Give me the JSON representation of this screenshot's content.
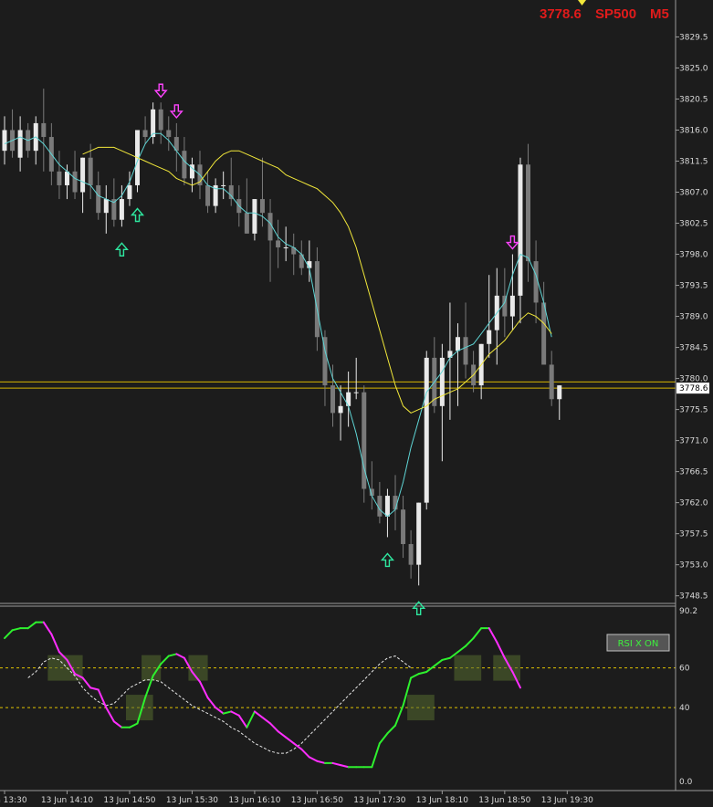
{
  "header": {
    "price": "3778.6",
    "symbol": "SP500",
    "timeframe": "M5"
  },
  "colors": {
    "background": "#1c1c1c",
    "candle_up": "#e9e9e9",
    "candle_down": "#7a7a7a",
    "ma_fast": "#5fd6d6",
    "ma_slow": "#f2e83a",
    "price_line": "#d6b400",
    "rsi_up": "#2ef02e",
    "rsi_down": "#ff2eff",
    "signal_up": "#2ee8a0",
    "signal_down": "#ff44ff"
  },
  "button": {
    "label": "RSI X ON"
  },
  "chart_data": [
    {
      "type": "candlestick",
      "title": "",
      "ylim": [
        3747.0,
        3833.0
      ],
      "y_ticks": [
        "3829.5",
        "3825.0",
        "3820.5",
        "3816.0",
        "3811.5",
        "3807.0",
        "3802.5",
        "3798.0",
        "3793.5",
        "3789.0",
        "3784.5",
        "3780.0",
        "3775.5",
        "3771.0",
        "3766.5",
        "3762.0",
        "3757.5",
        "3753.0",
        "3748.5"
      ],
      "current_price": 3778.6,
      "price_lines": [
        3779.5,
        3778.6
      ],
      "x_ticks": [
        "13 Jun 13:30",
        "13 Jun 14:10",
        "13 Jun 14:50",
        "13 Jun 15:30",
        "13 Jun 16:10",
        "13 Jun 16:50",
        "13 Jun 17:30",
        "13 Jun 18:10",
        "13 Jun 18:50",
        "13 Jun 19:30"
      ],
      "x_tick_bars": [
        0,
        8,
        16,
        24,
        32,
        40,
        48,
        56,
        64,
        72
      ],
      "candles_ohlc": [
        [
          3813,
          3818,
          3811,
          3816
        ],
        [
          3816,
          3819,
          3812,
          3813
        ],
        [
          3812,
          3818,
          3810,
          3816
        ],
        [
          3816,
          3817,
          3812,
          3813
        ],
        [
          3813,
          3818,
          3811,
          3817
        ],
        [
          3817,
          3822,
          3810,
          3815
        ],
        [
          3815,
          3817,
          3808,
          3810
        ],
        [
          3810,
          3813,
          3806,
          3808
        ],
        [
          3808,
          3811,
          3806,
          3810
        ],
        [
          3810,
          3813,
          3806,
          3807
        ],
        [
          3807,
          3812,
          3804,
          3812
        ],
        [
          3812,
          3814,
          3806,
          3808
        ],
        [
          3808,
          3810,
          3803,
          3804
        ],
        [
          3804,
          3808,
          3801,
          3806
        ],
        [
          3806,
          3809,
          3802,
          3803
        ],
        [
          3803,
          3808,
          3802,
          3806
        ],
        [
          3806,
          3810,
          3805,
          3808
        ],
        [
          3808,
          3816,
          3807,
          3816
        ],
        [
          3816,
          3818,
          3814,
          3815
        ],
        [
          3815,
          3820,
          3814,
          3819
        ],
        [
          3819,
          3820,
          3814,
          3816
        ],
        [
          3816,
          3818,
          3813,
          3815
        ],
        [
          3815,
          3817,
          3810,
          3813
        ],
        [
          3813,
          3815,
          3808,
          3809
        ],
        [
          3809,
          3812,
          3807,
          3811
        ],
        [
          3811,
          3813,
          3806,
          3808
        ],
        [
          3808,
          3810,
          3804,
          3805
        ],
        [
          3805,
          3809,
          3804,
          3808
        ],
        [
          3808,
          3810,
          3806,
          3808
        ],
        [
          3808,
          3812,
          3805,
          3806
        ],
        [
          3806,
          3808,
          3802,
          3804
        ],
        [
          3804,
          3809,
          3801,
          3801
        ],
        [
          3801,
          3806,
          3800,
          3806
        ],
        [
          3806,
          3812,
          3802,
          3804
        ],
        [
          3804,
          3806,
          3794,
          3800
        ],
        [
          3800,
          3803,
          3796,
          3799
        ],
        [
          3799,
          3802,
          3797,
          3799
        ],
        [
          3799,
          3801,
          3795,
          3798
        ],
        [
          3798,
          3800,
          3795,
          3796
        ],
        [
          3796,
          3800,
          3794,
          3797
        ],
        [
          3797,
          3799,
          3784,
          3786
        ],
        [
          3786,
          3787,
          3776,
          3779
        ],
        [
          3779,
          3782,
          3773,
          3775
        ],
        [
          3775,
          3779,
          3771,
          3776
        ],
        [
          3776,
          3781,
          3773,
          3778
        ],
        [
          3778,
          3783,
          3777,
          3778
        ],
        [
          3778,
          3779,
          3762,
          3764
        ],
        [
          3764,
          3768,
          3761,
          3763
        ],
        [
          3763,
          3765,
          3759,
          3760
        ],
        [
          3760,
          3764,
          3757,
          3763
        ],
        [
          3763,
          3766,
          3758,
          3761
        ],
        [
          3761,
          3763,
          3754,
          3756
        ],
        [
          3756,
          3758,
          3751,
          3753
        ],
        [
          3753,
          3762,
          3750,
          3762
        ],
        [
          3762,
          3784,
          3761,
          3783
        ],
        [
          3783,
          3786,
          3775,
          3776
        ],
        [
          3776,
          3785,
          3768,
          3783
        ],
        [
          3783,
          3791,
          3774,
          3784
        ],
        [
          3784,
          3788,
          3776,
          3786
        ],
        [
          3786,
          3791,
          3780,
          3782
        ],
        [
          3782,
          3784,
          3778,
          3779
        ],
        [
          3779,
          3785,
          3777,
          3785
        ],
        [
          3785,
          3795,
          3783,
          3787
        ],
        [
          3787,
          3796,
          3782,
          3792
        ],
        [
          3792,
          3796,
          3786,
          3789
        ],
        [
          3789,
          3798,
          3787,
          3792
        ],
        [
          3792,
          3812,
          3788,
          3811
        ],
        [
          3811,
          3814,
          3794,
          3797
        ],
        [
          3797,
          3800,
          3788,
          3791
        ],
        [
          3791,
          3794,
          3785,
          3782
        ],
        [
          3782,
          3784,
          3776,
          3777
        ],
        [
          3777,
          3779,
          3774,
          3779
        ]
      ],
      "ma_fast": [
        3814,
        3814.5,
        3815,
        3814.5,
        3815,
        3814,
        3812.5,
        3811,
        3810,
        3809,
        3808.5,
        3808,
        3806.5,
        3806,
        3805.5,
        3806.5,
        3808.5,
        3811.5,
        3814,
        3815.5,
        3815.5,
        3814.5,
        3813,
        3811.5,
        3810.5,
        3809.5,
        3808,
        3807.5,
        3807.5,
        3806.5,
        3805,
        3804,
        3804,
        3803.5,
        3802.5,
        3800.5,
        3799.5,
        3799,
        3798,
        3796,
        3790,
        3784,
        3780,
        3778,
        3776,
        3772,
        3767,
        3763,
        3761,
        3760,
        3761,
        3765,
        3770,
        3774,
        3778,
        3779.5,
        3781,
        3783,
        3784,
        3784.5,
        3785,
        3786.5,
        3788,
        3789.5,
        3791,
        3795,
        3798,
        3797.5,
        3795,
        3791,
        3786
      ],
      "ma_slow": [
        3812.5,
        3813,
        3813.5,
        3813.5,
        3813.5,
        3813,
        3812.5,
        3812,
        3811.5,
        3811,
        3810.5,
        3810,
        3809,
        3808.5,
        3808,
        3808.5,
        3810,
        3811.5,
        3812.5,
        3813,
        3813,
        3812.5,
        3812,
        3811.5,
        3811,
        3810.5,
        3809.5,
        3809,
        3808.5,
        3808,
        3807.5,
        3806.5,
        3805.5,
        3804,
        3802,
        3799,
        3795,
        3791,
        3787,
        3783,
        3779,
        3776,
        3775,
        3775.5,
        3776,
        3777,
        3777.5,
        3778,
        3778.5,
        3779.5,
        3780.5,
        3782,
        3783.5,
        3784.5,
        3785.5,
        3787,
        3788.5,
        3789.5,
        3789,
        3788,
        3786.5
      ],
      "ma_slow_start_bar": 10,
      "signals_up_bars": [
        15,
        17,
        49,
        53
      ],
      "signals_down_bars": [
        20,
        22,
        65
      ]
    },
    {
      "type": "line",
      "title": "",
      "ylim": [
        0,
        90.2
      ],
      "y_ticks": [
        "90.2",
        "60",
        "40",
        "0.0"
      ],
      "levels": [
        60,
        40
      ],
      "rsi": [
        75,
        79,
        80,
        80,
        83,
        83,
        77,
        68,
        64,
        57,
        55,
        50,
        49,
        40,
        33,
        30,
        30,
        32,
        45,
        56,
        62,
        66,
        67,
        65,
        58,
        53,
        45,
        40,
        37,
        38,
        36,
        30,
        38,
        35,
        32,
        28,
        25,
        22,
        19,
        15,
        13,
        12,
        12,
        11,
        10,
        10,
        10,
        10,
        22,
        27,
        31,
        41,
        55,
        57,
        58,
        61,
        64,
        65,
        68,
        71,
        75,
        80,
        80,
        73,
        65,
        58,
        50
      ],
      "rsi_signal": [
        55,
        58,
        63,
        65,
        64,
        60,
        56,
        50,
        46,
        43,
        41,
        42,
        46,
        50,
        52,
        54,
        54,
        53,
        50,
        47,
        44,
        41,
        39,
        37,
        35,
        33,
        30,
        28,
        25,
        22,
        20,
        18,
        17,
        17,
        19,
        22,
        26,
        30,
        34,
        38,
        42,
        46,
        50,
        54,
        58,
        62,
        65,
        66,
        63,
        60
      ],
      "rsi_signal_start_bar": 3,
      "zones": [
        {
          "bar": 6,
          "level": 60,
          "span": 4
        },
        {
          "bar": 16,
          "level": 40,
          "span": 3
        },
        {
          "bar": 18,
          "level": 60,
          "span": 2
        },
        {
          "bar": 24,
          "level": 60,
          "span": 2
        },
        {
          "bar": 52,
          "level": 40,
          "span": 3
        },
        {
          "bar": 58,
          "level": 60,
          "span": 3
        },
        {
          "bar": 63,
          "level": 60,
          "span": 3
        }
      ]
    }
  ]
}
